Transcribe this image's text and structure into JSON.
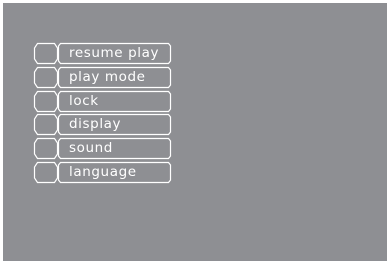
{
  "colors": {
    "screen_bg": "#8e8f93",
    "outline": "#ffffff",
    "text": "#ffffff"
  },
  "menu": {
    "items": [
      {
        "label": "resume play"
      },
      {
        "label": "play mode"
      },
      {
        "label": "lock"
      },
      {
        "label": "display"
      },
      {
        "label": "sound"
      },
      {
        "label": "language"
      }
    ]
  }
}
